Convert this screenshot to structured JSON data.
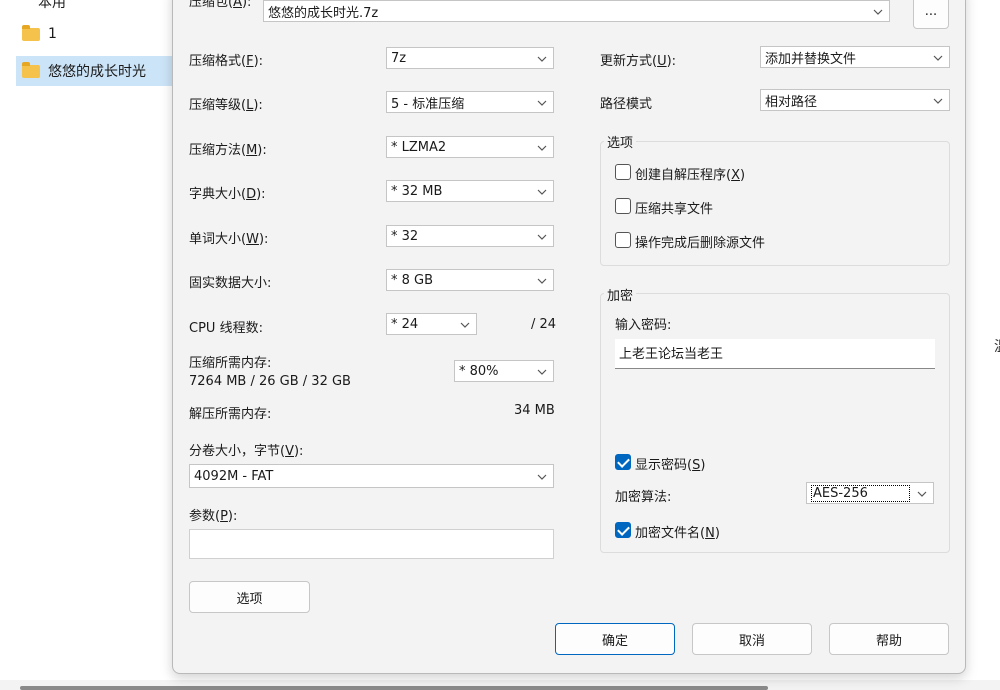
{
  "explorer": {
    "truncated_item": "本用",
    "folders": [
      "1",
      "悠悠的成长时光"
    ],
    "right_glyph": "温"
  },
  "dialog": {
    "archive": {
      "label_prefix": "压缩包(",
      "label_key": "A",
      "label_suffix": "):",
      "value": "悠悠的成长时光.7z",
      "browse_label": "..."
    },
    "format": {
      "label": "压缩格式(",
      "key": "F",
      "suffix": "):",
      "value": "7z"
    },
    "level": {
      "label": "压缩等级(",
      "key": "L",
      "suffix": "):",
      "value": "5 - 标准压缩"
    },
    "method": {
      "label": "压缩方法(",
      "key": "M",
      "suffix": "):",
      "value": "* LZMA2"
    },
    "dict": {
      "label": "字典大小(",
      "key": "D",
      "suffix": "):",
      "value": "* 32 MB"
    },
    "word": {
      "label": "单词大小(",
      "key": "W",
      "suffix": "):",
      "value": "* 32"
    },
    "solid": {
      "label": "固实数据大小:",
      "value": "* 8 GB"
    },
    "cpu": {
      "label": "CPU 线程数:",
      "value": "* 24",
      "max": "/ 24"
    },
    "mem_compress": {
      "label": "压缩所需内存:",
      "detail": "7264 MB / 26 GB / 32 GB",
      "value": "* 80%"
    },
    "mem_decompress": {
      "label": "解压所需内存:",
      "value": "34 MB"
    },
    "volume": {
      "label": "分卷大小，字节(",
      "key": "V",
      "suffix": "):",
      "value": "4092M - FAT"
    },
    "params": {
      "label": "参数(",
      "key": "P",
      "suffix": "):",
      "value": ""
    },
    "options_button": "选项",
    "update_mode": {
      "label": "更新方式(",
      "key": "U",
      "suffix": "):",
      "value": "添加并替换文件"
    },
    "path_mode": {
      "label": "路径模式",
      "value": "相对路径"
    },
    "options_group": {
      "title": "选项",
      "sfx": {
        "label": "创建自解压程序(",
        "key": "X",
        "suffix": ")",
        "checked": false
      },
      "shared": {
        "label": "压缩共享文件",
        "checked": false
      },
      "delete": {
        "label": "操作完成后删除源文件",
        "checked": false
      }
    },
    "encryption": {
      "title": "加密",
      "password_label": "输入密码:",
      "password_value": "上老王论坛当老王",
      "show_password": {
        "label": "显示密码(",
        "key": "S",
        "suffix": ")",
        "checked": true
      },
      "method_label": "加密算法:",
      "method_value": "AES-256",
      "encrypt_names": {
        "label": "加密文件名(",
        "key": "N",
        "suffix": ")",
        "checked": true
      }
    },
    "buttons": {
      "ok": "确定",
      "cancel": "取消",
      "help": "帮助"
    }
  }
}
